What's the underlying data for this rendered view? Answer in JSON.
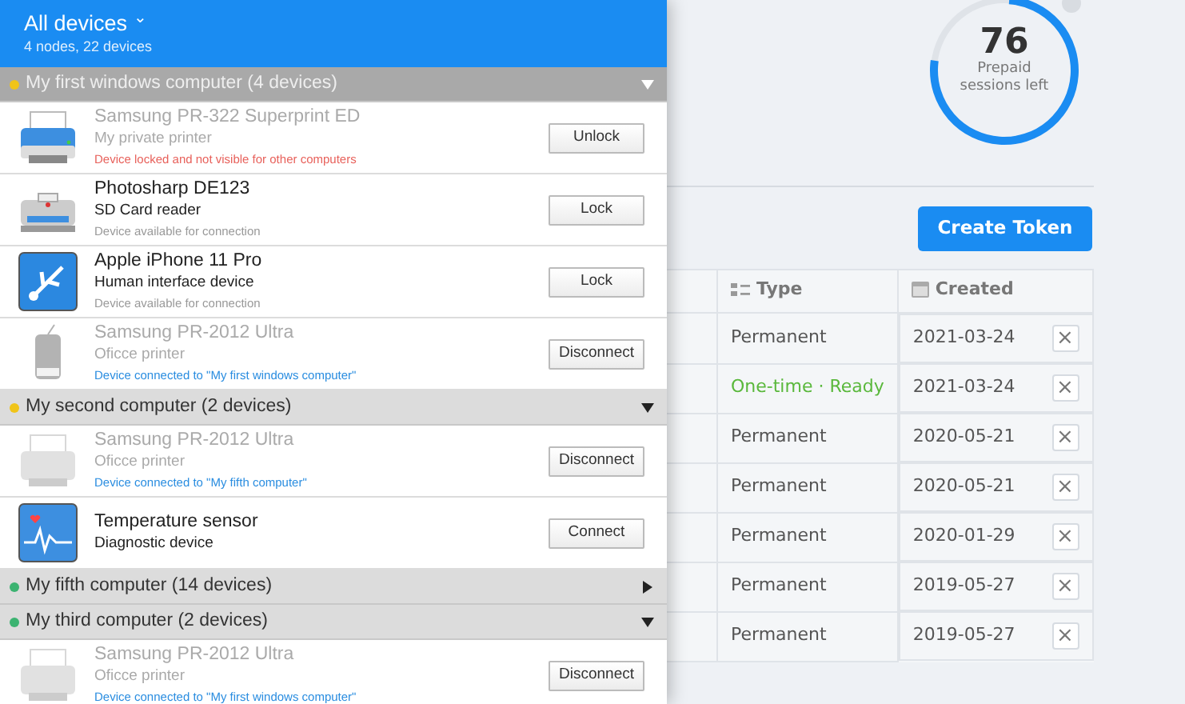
{
  "device_panel": {
    "title": "All devices",
    "caret": "⌄",
    "subtitle": "4 nodes, 22 devices",
    "groups": [
      {
        "name": "My first windows computer (4 devices)",
        "color": "#f0c419",
        "selected": true,
        "expanded": true,
        "devices": [
          {
            "kind": "printer",
            "name": "Samsung PR-322 Superprint ED",
            "type": "My private printer",
            "status": {
              "kind": "locked",
              "text": "Device locked and not visible for other computers"
            },
            "dimmed": true,
            "action": "Unlock"
          },
          {
            "kind": "card-reader",
            "name": "Photosharp DE123",
            "type": "SD Card reader",
            "status": {
              "kind": "available",
              "text": "Device available for connection"
            },
            "dimmed": false,
            "action": "Lock"
          },
          {
            "kind": "usb",
            "name": "Apple iPhone 11 Pro",
            "type": "Human interface device",
            "status": {
              "kind": "available",
              "text": "Device available for connection"
            },
            "dimmed": false,
            "action": "Lock"
          },
          {
            "kind": "drive",
            "name": "Samsung PR-2012 Ultra",
            "type": "Oficce printer",
            "status": {
              "kind": "connected",
              "text": "Device connected to \"My first windows computer\""
            },
            "dimmed": true,
            "action": "Disconnect"
          }
        ]
      },
      {
        "name": "My second computer (2 devices)",
        "color": "#f0c419",
        "selected": false,
        "expanded": true,
        "devices": [
          {
            "kind": "printer-grey",
            "name": "Samsung PR-2012 Ultra",
            "type": "Oficce printer",
            "status": {
              "kind": "connected",
              "text": "Device connected to \"My fifth computer\""
            },
            "dimmed": true,
            "action": "Disconnect"
          },
          {
            "kind": "monitor",
            "name": "Temperature sensor",
            "type": "Diagnostic device",
            "dimmed": false,
            "action": "Connect"
          }
        ]
      },
      {
        "name": "My fifth computer (14 devices)",
        "color": "#3cb371",
        "selected": false,
        "expanded": false
      },
      {
        "name": "My third computer (2 devices)",
        "color": "#3cb371",
        "selected": false,
        "expanded": true,
        "devices": [
          {
            "kind": "printer-grey",
            "name": "Samsung PR-2012 Ultra",
            "type": "Oficce printer",
            "status": {
              "kind": "connected",
              "text": "Device connected to \"My first windows computer\""
            },
            "dimmed": true,
            "action": "Disconnect"
          }
        ]
      }
    ]
  },
  "sessions_gauge": {
    "value": "76",
    "label": "Prepaid sessions left",
    "level": 0.76
  },
  "create_button": "Create Token",
  "tokens_table": {
    "columns": [
      {
        "label": "Type"
      },
      {
        "label": "Created"
      }
    ],
    "rows": [
      {
        "kind": "permanent",
        "type": "Permanent",
        "created": "2021-03-24",
        "remove": "×"
      },
      {
        "kind": "ready",
        "type": "One-time · Ready",
        "created": "2021-03-24",
        "remove": "×"
      },
      {
        "kind": "permanent",
        "type": "Permanent",
        "created": "2020-05-21",
        "remove": "×"
      },
      {
        "kind": "permanent",
        "type": "Permanent",
        "created": "2020-05-21",
        "remove": "×"
      },
      {
        "kind": "permanent",
        "type": "Permanent",
        "created": "2020-01-29",
        "remove": "×"
      },
      {
        "kind": "permanent",
        "type": "Permanent",
        "created": "2019-05-27",
        "remove": "×"
      },
      {
        "kind": "permanent",
        "type": "Permanent",
        "created": "2019-05-27",
        "remove": "×"
      }
    ]
  }
}
